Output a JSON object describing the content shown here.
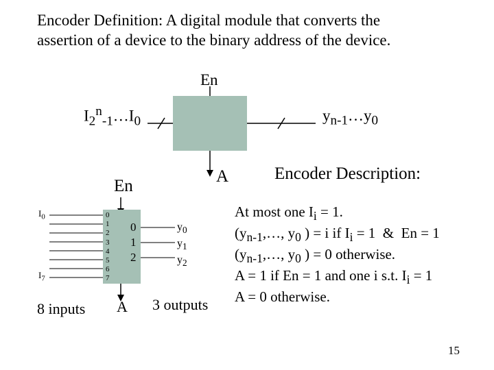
{
  "definition": "Encoder Definition: A digital module that converts the assertion of a device to the binary address of the device.",
  "top_diagram": {
    "en": "En",
    "inputs": "I<sub>2</sub><sup>n</sup><sub>-1</sub>…I<sub>0</sub>",
    "outputs": "y<sub>n-1</sub>…y<sub>0</sub>",
    "A": "A"
  },
  "bottom_diagram": {
    "en": "En",
    "left_top": "I<sub>0</sub>",
    "left_bot": "I<sub>7</sub>",
    "pin_nums": [
      "0",
      "1",
      "2",
      "3",
      "4",
      "5",
      "6",
      "7"
    ],
    "out_nums": [
      "0",
      "1",
      "2"
    ],
    "out_labels": [
      "y<sub>0</sub>",
      "y<sub>1</sub>",
      "y<sub>2</sub>"
    ],
    "eight": "8 inputs",
    "A": "A",
    "three": "3 outputs"
  },
  "description": {
    "title": "Encoder Description:",
    "lines": [
      "At most one I<sub>i</sub> = 1.",
      "(y<sub>n-1</sub>,…, y<sub>0</sub> ) = i if I<sub>i</sub> = 1 &nbsp;&amp;&nbsp; En = 1",
      "(y<sub>n-1</sub>,…, y<sub>0</sub> ) = 0 otherwise.",
      "A = 1 if En = 1 and one i s.t. I<sub>i</sub> = 1",
      "A = 0 otherwise."
    ]
  },
  "page": "15"
}
